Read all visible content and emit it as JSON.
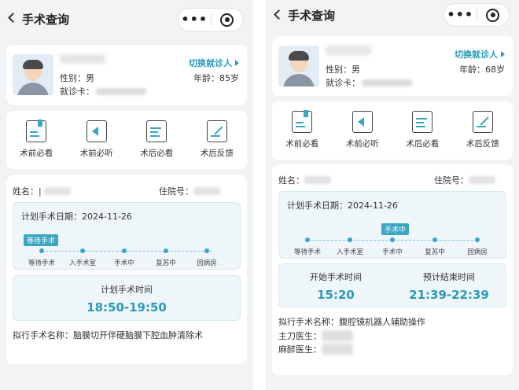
{
  "left": {
    "title": "手术查询",
    "more_glyph": "•••",
    "patient": {
      "switch_label": "切换就诊人",
      "gender_label": "性别：",
      "gender": "男",
      "age_label": "年龄：",
      "age": "85岁",
      "visit_label": "就诊卡："
    },
    "shortcuts": [
      "术前必看",
      "术前必听",
      "术后必看",
      "术后反馈"
    ],
    "surgery": {
      "name_label": "姓名：",
      "name_value": "|",
      "bed_label": "住院号：",
      "plan_date_label": "计划手术日期：",
      "plan_date": "2024-11-26",
      "status_badge": "等待手术",
      "stages": [
        "等待手术",
        "入手术室",
        "手术中",
        "复苏中",
        "回病房"
      ],
      "current_stage_index": 0,
      "time_title": "计划手术时间",
      "time_value": "18:50-19:50",
      "proc_label": "拟行手术名称：",
      "proc_name": "脑膜切开伴硬脑膜下腔血肿清除术"
    }
  },
  "right": {
    "title": "手术查询",
    "more_glyph": "•••",
    "patient": {
      "switch_label": "切换就诊人",
      "gender_label": "性别：",
      "gender": "男",
      "age_label": "年龄：",
      "age": "68岁",
      "visit_label": "就诊卡："
    },
    "shortcuts": [
      "术前必看",
      "术前必听",
      "术后必看",
      "术后反馈"
    ],
    "surgery": {
      "name_label": "姓名：",
      "bed_label": "住院号：",
      "plan_date_label": "计划手术日期：",
      "plan_date": "2024-11-26",
      "status_badge": "手术中",
      "stages": [
        "等待手术",
        "入手术室",
        "手术中",
        "复苏中",
        "回病房"
      ],
      "current_stage_index": 2,
      "start_title": "开始手术时间",
      "start_value": "15:20",
      "end_title": "预计结束时间",
      "end_value": "21:39-22:39",
      "proc_label": "拟行手术名称：",
      "proc_name": "腹腔镜机器人辅助操作",
      "surgeon_label": "主刀医生：",
      "anesth_label": "麻醉医生："
    }
  },
  "colors": {
    "accent": "#2a9ab8",
    "panel_bg": "#eef6fa",
    "page_bg": "#f2f3f5"
  }
}
